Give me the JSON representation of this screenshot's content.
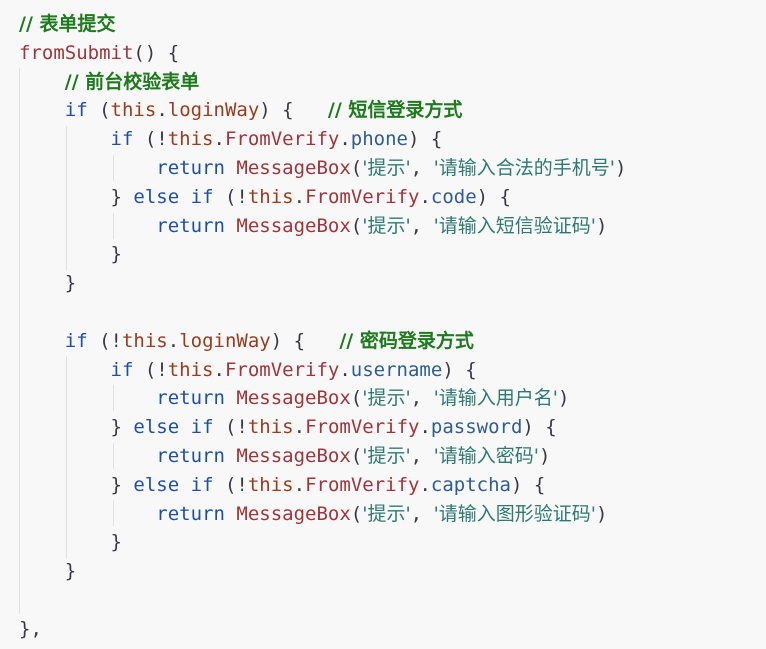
{
  "code": {
    "language": "javascript",
    "lines": [
      [
        {
          "t": "// 表单提交",
          "c": "com"
        }
      ],
      [
        {
          "t": "fromSubmit",
          "c": "fn"
        },
        {
          "t": "() {",
          "c": "punc"
        }
      ],
      [
        {
          "t": "    "
        },
        {
          "t": "// 前台校验表单",
          "c": "com"
        }
      ],
      [
        {
          "t": "    "
        },
        {
          "t": "if",
          "c": "kw"
        },
        {
          "t": " (",
          "c": "punc"
        },
        {
          "t": "this",
          "c": "this"
        },
        {
          "t": ".",
          "c": "punc"
        },
        {
          "t": "loginWay",
          "c": "this"
        },
        {
          "t": ") {   ",
          "c": "punc"
        },
        {
          "t": "// 短信登录方式",
          "c": "com"
        }
      ],
      [
        {
          "t": "        "
        },
        {
          "t": "if",
          "c": "kw"
        },
        {
          "t": " (!",
          "c": "punc"
        },
        {
          "t": "this",
          "c": "this"
        },
        {
          "t": ".",
          "c": "punc"
        },
        {
          "t": "FromVerify",
          "c": "fn"
        },
        {
          "t": ".",
          "c": "punc"
        },
        {
          "t": "phone",
          "c": "prop"
        },
        {
          "t": ") {",
          "c": "punc"
        }
      ],
      [
        {
          "t": "            "
        },
        {
          "t": "return",
          "c": "kw"
        },
        {
          "t": " "
        },
        {
          "t": "MessageBox",
          "c": "fn"
        },
        {
          "t": "(",
          "c": "punc"
        },
        {
          "t": "'提示'",
          "c": "str"
        },
        {
          "t": ", ",
          "c": "punc"
        },
        {
          "t": "'请输入合法的手机号'",
          "c": "str"
        },
        {
          "t": ")",
          "c": "punc"
        }
      ],
      [
        {
          "t": "        "
        },
        {
          "t": "} ",
          "c": "punc"
        },
        {
          "t": "else",
          "c": "kw"
        },
        {
          "t": " "
        },
        {
          "t": "if",
          "c": "kw"
        },
        {
          "t": " (!",
          "c": "punc"
        },
        {
          "t": "this",
          "c": "this"
        },
        {
          "t": ".",
          "c": "punc"
        },
        {
          "t": "FromVerify",
          "c": "fn"
        },
        {
          "t": ".",
          "c": "punc"
        },
        {
          "t": "code",
          "c": "prop"
        },
        {
          "t": ") {",
          "c": "punc"
        }
      ],
      [
        {
          "t": "            "
        },
        {
          "t": "return",
          "c": "kw"
        },
        {
          "t": " "
        },
        {
          "t": "MessageBox",
          "c": "fn"
        },
        {
          "t": "(",
          "c": "punc"
        },
        {
          "t": "'提示'",
          "c": "str"
        },
        {
          "t": ", ",
          "c": "punc"
        },
        {
          "t": "'请输入短信验证码'",
          "c": "str"
        },
        {
          "t": ")",
          "c": "punc"
        }
      ],
      [
        {
          "t": "        "
        },
        {
          "t": "}",
          "c": "punc"
        }
      ],
      [
        {
          "t": "    "
        },
        {
          "t": "}",
          "c": "punc"
        }
      ],
      [],
      [
        {
          "t": "    "
        },
        {
          "t": "if",
          "c": "kw"
        },
        {
          "t": " (!",
          "c": "punc"
        },
        {
          "t": "this",
          "c": "this"
        },
        {
          "t": ".",
          "c": "punc"
        },
        {
          "t": "loginWay",
          "c": "this"
        },
        {
          "t": ") {   ",
          "c": "punc"
        },
        {
          "t": "// 密码登录方式",
          "c": "com"
        }
      ],
      [
        {
          "t": "        "
        },
        {
          "t": "if",
          "c": "kw"
        },
        {
          "t": " (!",
          "c": "punc"
        },
        {
          "t": "this",
          "c": "this"
        },
        {
          "t": ".",
          "c": "punc"
        },
        {
          "t": "FromVerify",
          "c": "fn"
        },
        {
          "t": ".",
          "c": "punc"
        },
        {
          "t": "username",
          "c": "prop"
        },
        {
          "t": ") {",
          "c": "punc"
        }
      ],
      [
        {
          "t": "            "
        },
        {
          "t": "return",
          "c": "kw"
        },
        {
          "t": " "
        },
        {
          "t": "MessageBox",
          "c": "fn"
        },
        {
          "t": "(",
          "c": "punc"
        },
        {
          "t": "'提示'",
          "c": "str"
        },
        {
          "t": ", ",
          "c": "punc"
        },
        {
          "t": "'请输入用户名'",
          "c": "str"
        },
        {
          "t": ")",
          "c": "punc"
        }
      ],
      [
        {
          "t": "        "
        },
        {
          "t": "} ",
          "c": "punc"
        },
        {
          "t": "else",
          "c": "kw"
        },
        {
          "t": " "
        },
        {
          "t": "if",
          "c": "kw"
        },
        {
          "t": " (!",
          "c": "punc"
        },
        {
          "t": "this",
          "c": "this"
        },
        {
          "t": ".",
          "c": "punc"
        },
        {
          "t": "FromVerify",
          "c": "fn"
        },
        {
          "t": ".",
          "c": "punc"
        },
        {
          "t": "password",
          "c": "prop"
        },
        {
          "t": ") {",
          "c": "punc"
        }
      ],
      [
        {
          "t": "            "
        },
        {
          "t": "return",
          "c": "kw"
        },
        {
          "t": " "
        },
        {
          "t": "MessageBox",
          "c": "fn"
        },
        {
          "t": "(",
          "c": "punc"
        },
        {
          "t": "'提示'",
          "c": "str"
        },
        {
          "t": ", ",
          "c": "punc"
        },
        {
          "t": "'请输入密码'",
          "c": "str"
        },
        {
          "t": ")",
          "c": "punc"
        }
      ],
      [
        {
          "t": "        "
        },
        {
          "t": "} ",
          "c": "punc"
        },
        {
          "t": "else",
          "c": "kw"
        },
        {
          "t": " "
        },
        {
          "t": "if",
          "c": "kw"
        },
        {
          "t": " (!",
          "c": "punc"
        },
        {
          "t": "this",
          "c": "this"
        },
        {
          "t": ".",
          "c": "punc"
        },
        {
          "t": "FromVerify",
          "c": "fn"
        },
        {
          "t": ".",
          "c": "punc"
        },
        {
          "t": "captcha",
          "c": "prop"
        },
        {
          "t": ") {",
          "c": "punc"
        }
      ],
      [
        {
          "t": "            "
        },
        {
          "t": "return",
          "c": "kw"
        },
        {
          "t": " "
        },
        {
          "t": "MessageBox",
          "c": "fn"
        },
        {
          "t": "(",
          "c": "punc"
        },
        {
          "t": "'提示'",
          "c": "str"
        },
        {
          "t": ", ",
          "c": "punc"
        },
        {
          "t": "'请输入图形验证码'",
          "c": "str"
        },
        {
          "t": ")",
          "c": "punc"
        }
      ],
      [
        {
          "t": "        "
        },
        {
          "t": "}",
          "c": "punc"
        }
      ],
      [
        {
          "t": "    "
        },
        {
          "t": "}",
          "c": "punc"
        }
      ],
      [],
      [
        {
          "t": "},",
          "c": "punc"
        }
      ]
    ]
  },
  "colors": {
    "background": "#f8f8f8",
    "keyword": "#1d4fa8",
    "this": "#9b3a1c",
    "function": "#a0343a",
    "property": "#2c5d95",
    "string": "#2e7a72",
    "comment": "#1d7a1d",
    "indent_guide": "#e1e1e1"
  }
}
